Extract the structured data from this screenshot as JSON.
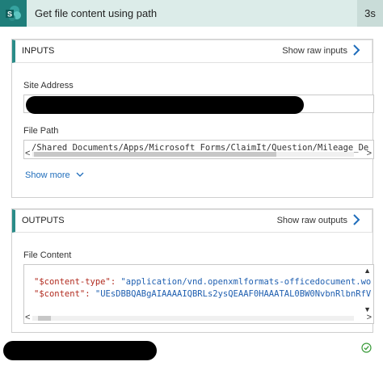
{
  "header": {
    "title": "Get file content using path",
    "duration": "3s",
    "icon": "sharepoint-icon",
    "accent": "#1f7e7a"
  },
  "inputs": {
    "label": "INPUTS",
    "raw_link": "Show raw inputs",
    "site_address_label": "Site Address",
    "file_path_label": "File Path",
    "file_path_value": "/Shared Documents/Apps/Microsoft Forms/ClaimIt/Question/Mileage_De",
    "show_more": "Show more"
  },
  "outputs": {
    "label": "OUTPUTS",
    "raw_link": "Show raw outputs",
    "file_content_label": "File Content",
    "line1_key": "\"$content-type\":",
    "line1_val": "\"application/vnd.openxmlformats-officedocument.wo",
    "line2_key": "\"$content\":",
    "line2_val": "\"UEsDBBQABgAIAAAAIQBRLs2ysQEAAF0HAAATAL0BW0NvbnRlbnRfV"
  },
  "status": {
    "icon": "success-check-icon",
    "color": "#3a9b3a"
  }
}
